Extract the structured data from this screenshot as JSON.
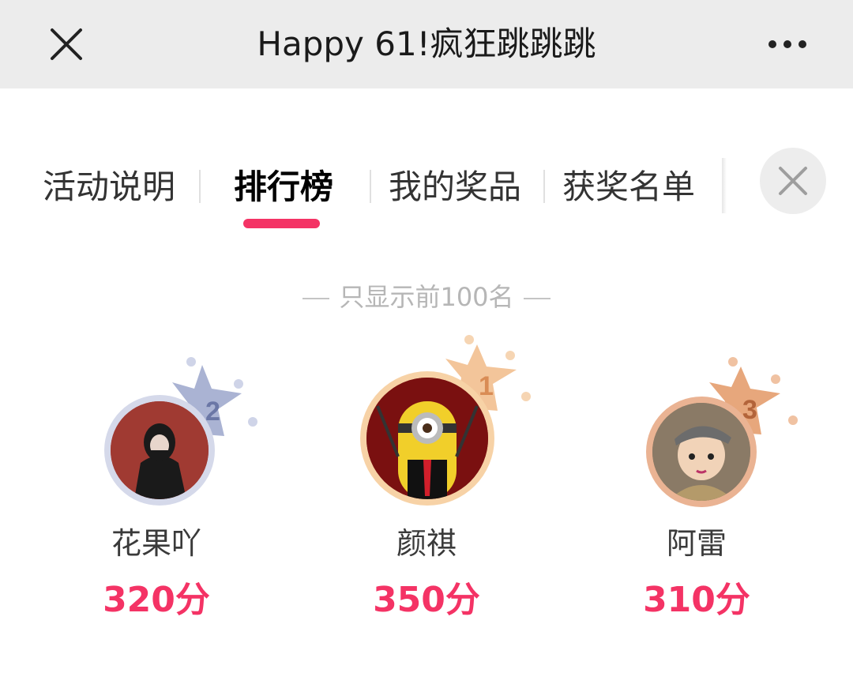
{
  "nav": {
    "title": "Happy 61!疯狂跳跳跳",
    "close_icon": "close-icon",
    "more_icon": "more-dots-icon"
  },
  "tabs": [
    {
      "label": "活动说明",
      "active": false
    },
    {
      "label": "排行榜",
      "active": true
    },
    {
      "label": "我的奖品",
      "active": false
    },
    {
      "label": "获奖名单",
      "active": false
    }
  ],
  "tab_close_icon": "close-icon",
  "notice": "只显示前100名",
  "leaderboard": [
    {
      "rank": "2",
      "name": "花果吖",
      "score": "320分",
      "crown_color": "#aab3d3",
      "ring_color": "#d5d9ea"
    },
    {
      "rank": "1",
      "name": "颜祺",
      "score": "350分",
      "crown_color": "#f3c59a",
      "ring_color": "#f7d2a6"
    },
    {
      "rank": "3",
      "name": "阿雷",
      "score": "310分",
      "crown_color": "#e7a77c",
      "ring_color": "#eab393"
    }
  ],
  "colors": {
    "accent": "#f43365",
    "nav_bg": "#ececec"
  }
}
